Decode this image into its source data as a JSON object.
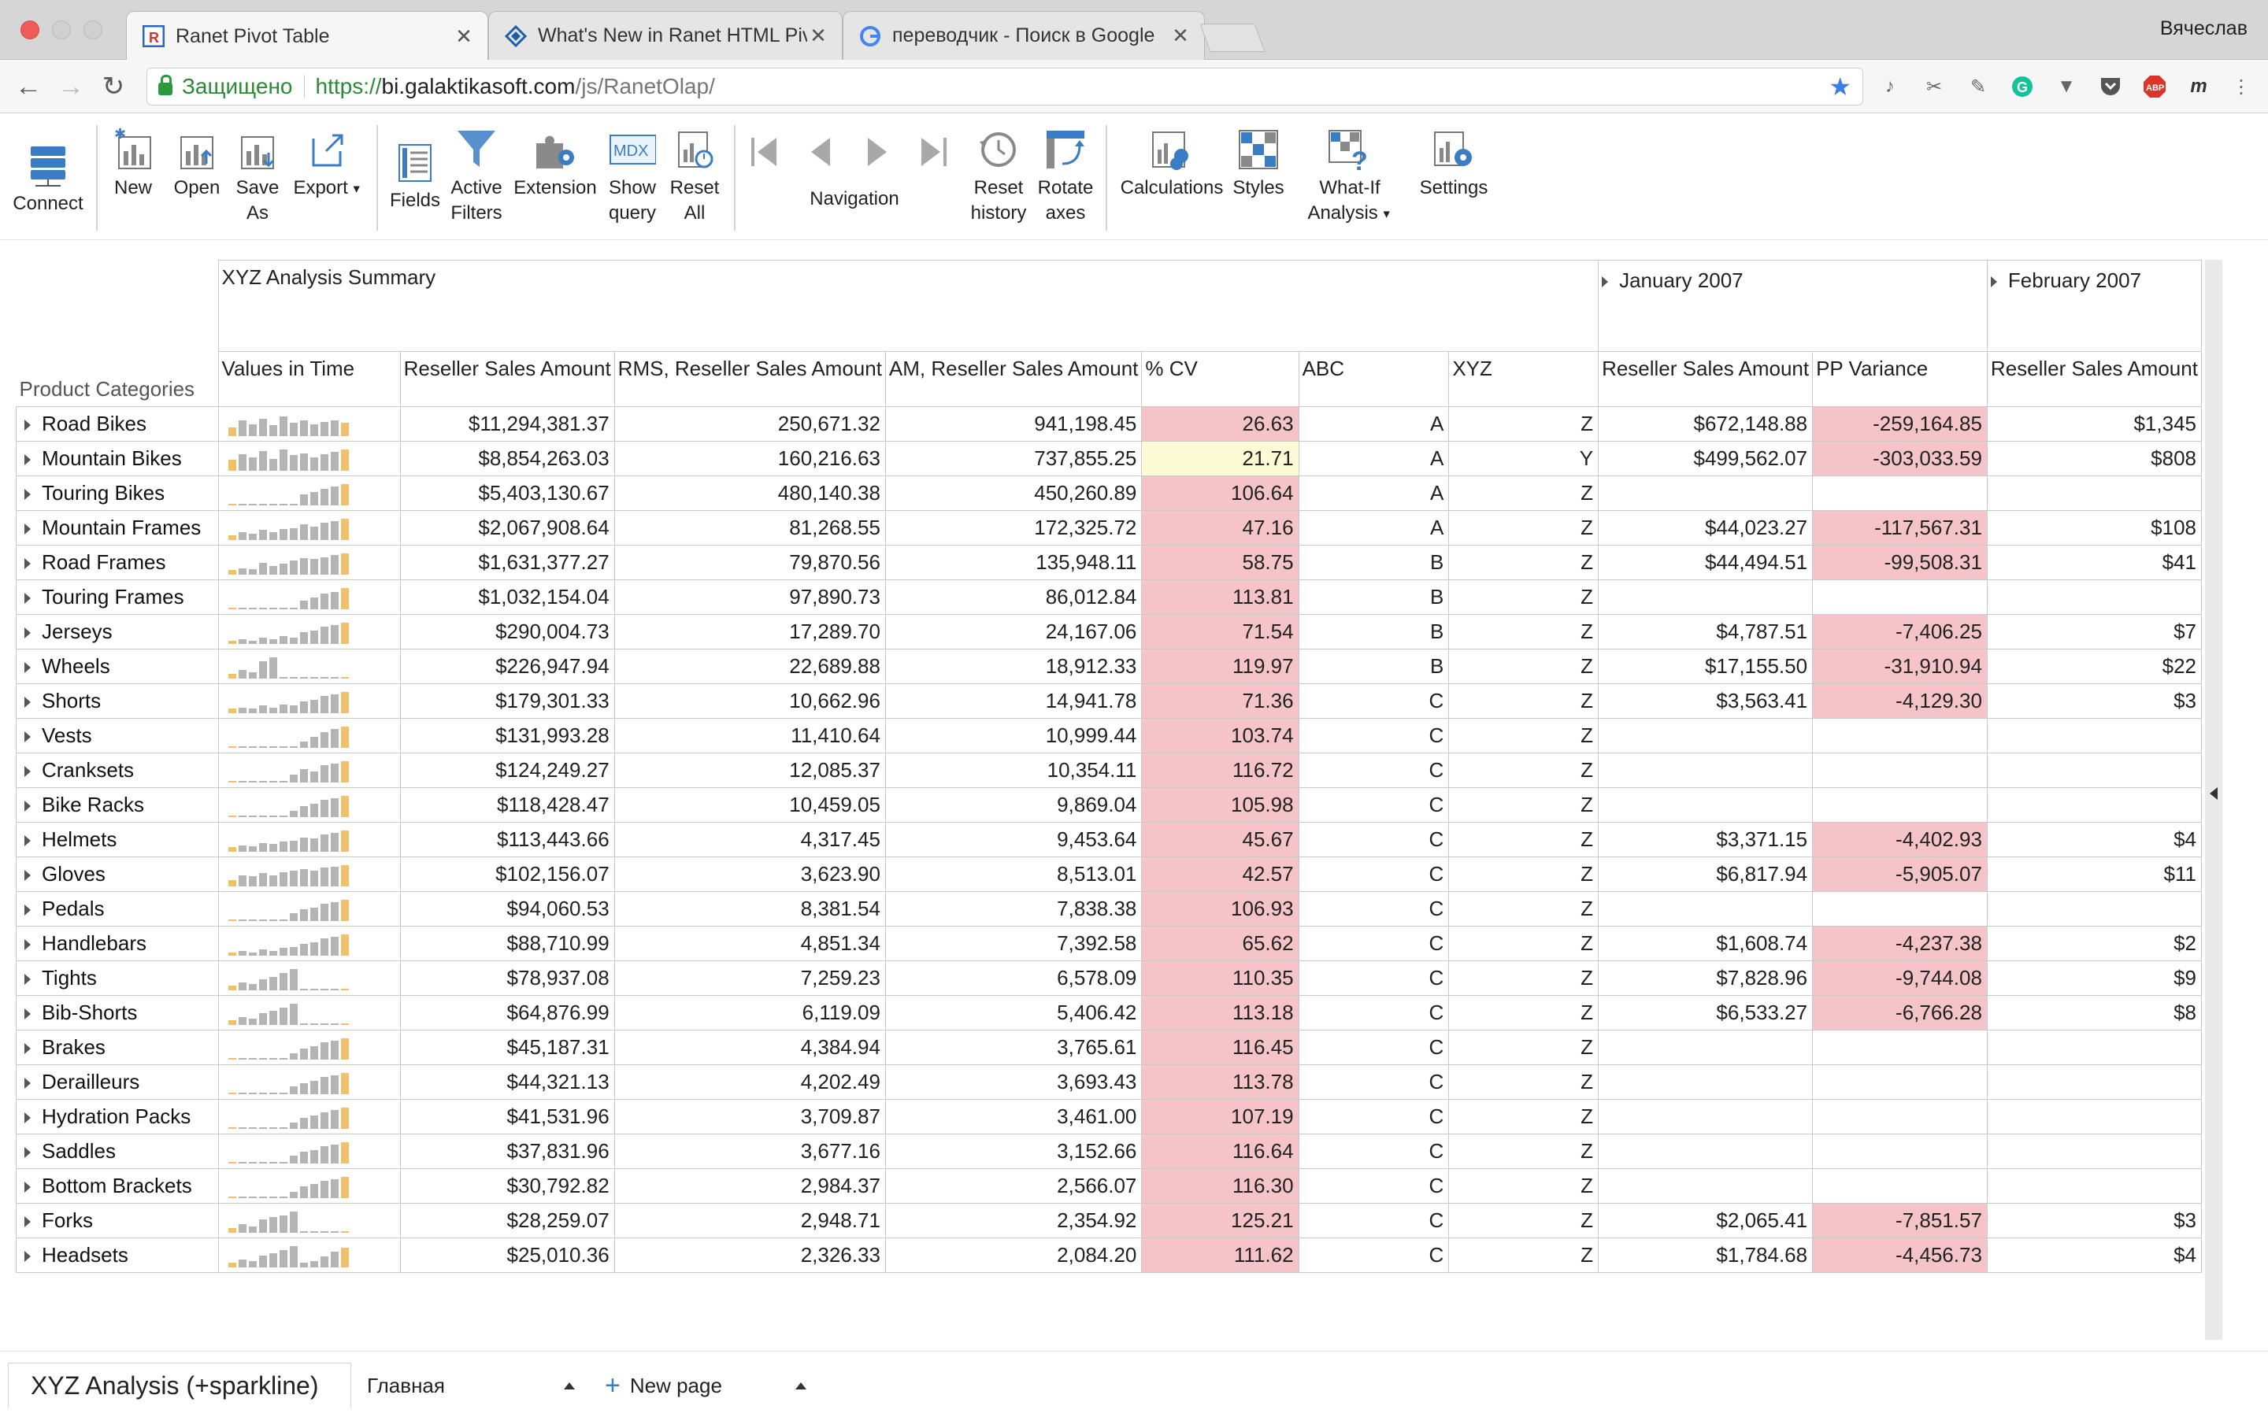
{
  "browser": {
    "tabs": [
      {
        "title": "Ranet Pivot Table",
        "active": true
      },
      {
        "title": "What's New in Ranet HTML Pivot",
        "active": false
      },
      {
        "title": "переводчик - Поиск в Google",
        "active": false
      }
    ],
    "profile": "Вячеслав",
    "secure_label": "Защищено",
    "url_scheme": "https://",
    "url_host": "bi.galaktikasoft.com",
    "url_path": "/js/RanetOlap/"
  },
  "toolbar": {
    "connect": "Connect",
    "new": "New",
    "open": "Open",
    "save_as_1": "Save",
    "save_as_2": "As",
    "export": "Export",
    "fields": "Fields",
    "active_filters_1": "Active",
    "active_filters_2": "Filters",
    "extension": "Extension",
    "show_query_1": "Show",
    "show_query_2": "query",
    "mdx": "MDX",
    "reset_all_1": "Reset",
    "reset_all_2": "All",
    "navigation": "Navigation",
    "reset_history_1": "Reset",
    "reset_history_2": "history",
    "rotate_axes_1": "Rotate",
    "rotate_axes_2": "axes",
    "calculations": "Calculations",
    "styles": "Styles",
    "what_if_1": "What-If",
    "what_if_2": "Analysis",
    "settings": "Settings"
  },
  "pivot": {
    "summary_title": "XYZ Analysis Summary",
    "period_1": "January 2007",
    "period_2": "February 2007",
    "row_axis_label": "Product Categories",
    "columns": [
      "Values in Time",
      "Reseller Sales Amount",
      "RMS, Reseller Sales Amount",
      "AM, Reseller Sales Amount",
      "% CV",
      "ABC",
      "XYZ",
      "Reseller Sales Amount",
      "PP Variance",
      "Reseller Sales Amount"
    ],
    "colors": {
      "pink": "#f4c4c9",
      "yellow": "#fdfbd6",
      "spark_gray": "#b4b4b4",
      "spark_orange": "#f1c06a"
    },
    "rows": [
      {
        "name": "Road Bikes",
        "rsa": "$11,294,381.37",
        "rms": "250,671.32",
        "am": "941,198.45",
        "cv": "26.63",
        "cv_color": "pink",
        "abc": "A",
        "xyz": "Z",
        "jan_rsa": "$672,148.88",
        "jan_pp": "-259,164.85",
        "feb_rsa": "$1,345",
        "spark": [
          0.4,
          0.7,
          0.55,
          0.8,
          0.5,
          0.9,
          0.6,
          0.7,
          0.55,
          0.65,
          0.7,
          0.6
        ]
      },
      {
        "name": "Mountain Bikes",
        "rsa": "$8,854,263.03",
        "rms": "160,216.63",
        "am": "737,855.25",
        "cv": "21.71",
        "cv_color": "yellow",
        "abc": "A",
        "xyz": "Y",
        "jan_rsa": "$499,562.07",
        "jan_pp": "-303,033.59",
        "feb_rsa": "$808",
        "spark": [
          0.5,
          0.75,
          0.6,
          0.9,
          0.55,
          0.95,
          0.7,
          0.8,
          0.6,
          0.75,
          0.85,
          0.95
        ]
      },
      {
        "name": "Touring Bikes",
        "rsa": "$5,403,130.67",
        "rms": "480,140.38",
        "am": "450,260.89",
        "cv": "106.64",
        "cv_color": "pink",
        "abc": "A",
        "xyz": "Z",
        "jan_rsa": "",
        "jan_pp": "",
        "feb_rsa": "",
        "spark": [
          0.08,
          0.08,
          0.08,
          0.08,
          0.08,
          0.08,
          0.08,
          0.5,
          0.6,
          0.75,
          0.85,
          0.95
        ]
      },
      {
        "name": "Mountain Frames",
        "rsa": "$2,067,908.64",
        "rms": "81,268.55",
        "am": "172,325.72",
        "cv": "47.16",
        "cv_color": "pink",
        "abc": "A",
        "xyz": "Z",
        "jan_rsa": "$44,023.27",
        "jan_pp": "-117,567.31",
        "feb_rsa": "$108",
        "spark": [
          0.2,
          0.35,
          0.3,
          0.45,
          0.35,
          0.5,
          0.55,
          0.7,
          0.6,
          0.8,
          0.85,
          0.95
        ]
      },
      {
        "name": "Road Frames",
        "rsa": "$1,631,377.27",
        "rms": "79,870.56",
        "am": "135,948.11",
        "cv": "58.75",
        "cv_color": "pink",
        "abc": "B",
        "xyz": "Z",
        "jan_rsa": "$44,494.51",
        "jan_pp": "-99,508.31",
        "feb_rsa": "$41",
        "spark": [
          0.2,
          0.3,
          0.25,
          0.55,
          0.4,
          0.5,
          0.65,
          0.75,
          0.7,
          0.8,
          0.9,
          0.95
        ]
      },
      {
        "name": "Touring Frames",
        "rsa": "$1,032,154.04",
        "rms": "97,890.73",
        "am": "86,012.84",
        "cv": "113.81",
        "cv_color": "pink",
        "abc": "B",
        "xyz": "Z",
        "jan_rsa": "",
        "jan_pp": "",
        "feb_rsa": "",
        "spark": [
          0.08,
          0.08,
          0.08,
          0.08,
          0.08,
          0.08,
          0.08,
          0.4,
          0.55,
          0.7,
          0.8,
          0.95
        ]
      },
      {
        "name": "Jerseys",
        "rsa": "$290,004.73",
        "rms": "17,289.70",
        "am": "24,167.06",
        "cv": "71.54",
        "cv_color": "pink",
        "abc": "B",
        "xyz": "Z",
        "jan_rsa": "$4,787.51",
        "jan_pp": "-7,406.25",
        "feb_rsa": "$7",
        "spark": [
          0.15,
          0.2,
          0.15,
          0.3,
          0.2,
          0.35,
          0.3,
          0.55,
          0.6,
          0.8,
          0.85,
          0.95
        ]
      },
      {
        "name": "Wheels",
        "rsa": "$226,947.94",
        "rms": "22,689.88",
        "am": "18,912.33",
        "cv": "119.97",
        "cv_color": "pink",
        "abc": "B",
        "xyz": "Z",
        "jan_rsa": "$17,155.50",
        "jan_pp": "-31,910.94",
        "feb_rsa": "$22",
        "spark": [
          0.2,
          0.4,
          0.3,
          0.8,
          0.95,
          0.08,
          0.08,
          0.08,
          0.08,
          0.08,
          0.08,
          0.08
        ]
      },
      {
        "name": "Shorts",
        "rsa": "$179,301.33",
        "rms": "10,662.96",
        "am": "14,941.78",
        "cv": "71.36",
        "cv_color": "pink",
        "abc": "C",
        "xyz": "Z",
        "jan_rsa": "$3,563.41",
        "jan_pp": "-4,129.30",
        "feb_rsa": "$3",
        "spark": [
          0.2,
          0.25,
          0.2,
          0.35,
          0.25,
          0.4,
          0.35,
          0.55,
          0.6,
          0.8,
          0.85,
          0.95
        ]
      },
      {
        "name": "Vests",
        "rsa": "$131,993.28",
        "rms": "11,410.64",
        "am": "10,999.44",
        "cv": "103.74",
        "cv_color": "pink",
        "abc": "C",
        "xyz": "Z",
        "jan_rsa": "",
        "jan_pp": "",
        "feb_rsa": "",
        "spark": [
          0.08,
          0.08,
          0.08,
          0.08,
          0.08,
          0.08,
          0.08,
          0.3,
          0.5,
          0.7,
          0.85,
          0.95
        ]
      },
      {
        "name": "Cranksets",
        "rsa": "$124,249.27",
        "rms": "12,085.37",
        "am": "10,354.11",
        "cv": "116.72",
        "cv_color": "pink",
        "abc": "C",
        "xyz": "Z",
        "jan_rsa": "",
        "jan_pp": "",
        "feb_rsa": "",
        "spark": [
          0.08,
          0.08,
          0.08,
          0.08,
          0.08,
          0.08,
          0.35,
          0.6,
          0.5,
          0.8,
          0.85,
          0.95
        ]
      },
      {
        "name": "Bike Racks",
        "rsa": "$118,428.47",
        "rms": "10,459.05",
        "am": "9,869.04",
        "cv": "105.98",
        "cv_color": "pink",
        "abc": "C",
        "xyz": "Z",
        "jan_rsa": "",
        "jan_pp": "",
        "feb_rsa": "",
        "spark": [
          0.08,
          0.08,
          0.08,
          0.08,
          0.08,
          0.08,
          0.3,
          0.5,
          0.6,
          0.8,
          0.85,
          0.95
        ]
      },
      {
        "name": "Helmets",
        "rsa": "$113,443.66",
        "rms": "4,317.45",
        "am": "9,453.64",
        "cv": "45.67",
        "cv_color": "pink",
        "abc": "C",
        "xyz": "Z",
        "jan_rsa": "$3,371.15",
        "jan_pp": "-4,402.93",
        "feb_rsa": "$4",
        "spark": [
          0.2,
          0.3,
          0.25,
          0.4,
          0.35,
          0.45,
          0.5,
          0.65,
          0.6,
          0.8,
          0.85,
          0.95
        ]
      },
      {
        "name": "Gloves",
        "rsa": "$102,156.07",
        "rms": "3,623.90",
        "am": "8,513.01",
        "cv": "42.57",
        "cv_color": "pink",
        "abc": "C",
        "xyz": "Z",
        "jan_rsa": "$6,817.94",
        "jan_pp": "-5,905.07",
        "feb_rsa": "$11",
        "spark": [
          0.3,
          0.5,
          0.45,
          0.6,
          0.5,
          0.65,
          0.7,
          0.8,
          0.7,
          0.85,
          0.9,
          0.95
        ]
      },
      {
        "name": "Pedals",
        "rsa": "$94,060.53",
        "rms": "8,381.54",
        "am": "7,838.38",
        "cv": "106.93",
        "cv_color": "pink",
        "abc": "C",
        "xyz": "Z",
        "jan_rsa": "",
        "jan_pp": "",
        "feb_rsa": "",
        "spark": [
          0.08,
          0.08,
          0.08,
          0.08,
          0.08,
          0.08,
          0.35,
          0.55,
          0.6,
          0.8,
          0.85,
          0.95
        ]
      },
      {
        "name": "Handlebars",
        "rsa": "$88,710.99",
        "rms": "4,851.34",
        "am": "7,392.58",
        "cv": "65.62",
        "cv_color": "pink",
        "abc": "C",
        "xyz": "Z",
        "jan_rsa": "$1,608.74",
        "jan_pp": "-4,237.38",
        "feb_rsa": "$2",
        "spark": [
          0.15,
          0.2,
          0.15,
          0.3,
          0.2,
          0.35,
          0.4,
          0.55,
          0.6,
          0.8,
          0.85,
          0.95
        ]
      },
      {
        "name": "Tights",
        "rsa": "$78,937.08",
        "rms": "7,259.23",
        "am": "6,578.09",
        "cv": "110.35",
        "cv_color": "pink",
        "abc": "C",
        "xyz": "Z",
        "jan_rsa": "$7,828.96",
        "jan_pp": "-9,744.08",
        "feb_rsa": "$9",
        "spark": [
          0.2,
          0.35,
          0.3,
          0.5,
          0.6,
          0.8,
          0.95,
          0.08,
          0.08,
          0.08,
          0.08,
          0.08
        ]
      },
      {
        "name": "Bib-Shorts",
        "rsa": "$64,876.99",
        "rms": "6,119.09",
        "am": "5,406.42",
        "cv": "113.18",
        "cv_color": "pink",
        "abc": "C",
        "xyz": "Z",
        "jan_rsa": "$6,533.27",
        "jan_pp": "-6,766.28",
        "feb_rsa": "$8",
        "spark": [
          0.2,
          0.35,
          0.3,
          0.55,
          0.65,
          0.8,
          0.95,
          0.08,
          0.08,
          0.08,
          0.08,
          0.08
        ]
      },
      {
        "name": "Brakes",
        "rsa": "$45,187.31",
        "rms": "4,384.94",
        "am": "3,765.61",
        "cv": "116.45",
        "cv_color": "pink",
        "abc": "C",
        "xyz": "Z",
        "jan_rsa": "",
        "jan_pp": "",
        "feb_rsa": "",
        "spark": [
          0.08,
          0.08,
          0.08,
          0.08,
          0.08,
          0.08,
          0.3,
          0.5,
          0.6,
          0.8,
          0.85,
          0.95
        ]
      },
      {
        "name": "Derailleurs",
        "rsa": "$44,321.13",
        "rms": "4,202.49",
        "am": "3,693.43",
        "cv": "113.78",
        "cv_color": "pink",
        "abc": "C",
        "xyz": "Z",
        "jan_rsa": "",
        "jan_pp": "",
        "feb_rsa": "",
        "spark": [
          0.08,
          0.08,
          0.08,
          0.08,
          0.08,
          0.08,
          0.35,
          0.5,
          0.6,
          0.8,
          0.85,
          0.95
        ]
      },
      {
        "name": "Hydration Packs",
        "rsa": "$41,531.96",
        "rms": "3,709.87",
        "am": "3,461.00",
        "cv": "107.19",
        "cv_color": "pink",
        "abc": "C",
        "xyz": "Z",
        "jan_rsa": "",
        "jan_pp": "",
        "feb_rsa": "",
        "spark": [
          0.08,
          0.08,
          0.08,
          0.08,
          0.08,
          0.08,
          0.3,
          0.5,
          0.6,
          0.75,
          0.85,
          0.95
        ]
      },
      {
        "name": "Saddles",
        "rsa": "$37,831.96",
        "rms": "3,677.16",
        "am": "3,152.66",
        "cv": "116.64",
        "cv_color": "pink",
        "abc": "C",
        "xyz": "Z",
        "jan_rsa": "",
        "jan_pp": "",
        "feb_rsa": "",
        "spark": [
          0.08,
          0.08,
          0.08,
          0.08,
          0.08,
          0.08,
          0.35,
          0.55,
          0.6,
          0.8,
          0.85,
          0.95
        ]
      },
      {
        "name": "Bottom Brackets",
        "rsa": "$30,792.82",
        "rms": "2,984.37",
        "am": "2,566.07",
        "cv": "116.30",
        "cv_color": "pink",
        "abc": "C",
        "xyz": "Z",
        "jan_rsa": "",
        "jan_pp": "",
        "feb_rsa": "",
        "spark": [
          0.08,
          0.08,
          0.08,
          0.08,
          0.08,
          0.08,
          0.3,
          0.55,
          0.65,
          0.8,
          0.85,
          0.95
        ]
      },
      {
        "name": "Forks",
        "rsa": "$28,259.07",
        "rms": "2,948.71",
        "am": "2,354.92",
        "cv": "125.21",
        "cv_color": "pink",
        "abc": "C",
        "xyz": "Z",
        "jan_rsa": "$2,065.41",
        "jan_pp": "-7,851.57",
        "feb_rsa": "$3",
        "spark": [
          0.2,
          0.4,
          0.3,
          0.6,
          0.7,
          0.8,
          0.95,
          0.08,
          0.08,
          0.08,
          0.08,
          0.08
        ]
      },
      {
        "name": "Headsets",
        "rsa": "$25,010.36",
        "rms": "2,326.33",
        "am": "2,084.20",
        "cv": "111.62",
        "cv_color": "pink",
        "abc": "C",
        "xyz": "Z",
        "jan_rsa": "$1,784.68",
        "jan_pp": "-4,456.73",
        "feb_rsa": "$4",
        "spark": [
          0.2,
          0.35,
          0.3,
          0.55,
          0.65,
          0.8,
          0.95,
          0.2,
          0.3,
          0.5,
          0.7,
          0.9
        ]
      }
    ]
  },
  "bottom_tabs": {
    "active": "XYZ Analysis (+sparkline)",
    "home": "Главная",
    "new_page": "New page"
  }
}
